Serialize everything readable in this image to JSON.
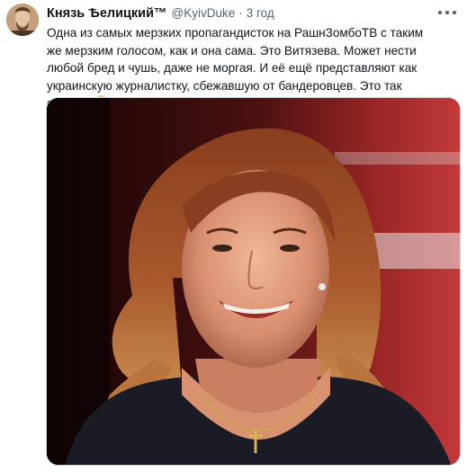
{
  "tweet": {
    "display_name": "Князь Ѣелицкий™",
    "handle": "@KyivDuke",
    "separator": "·",
    "time": "3 год",
    "text": "Одна из самых мерзких пропагандисток на РашнЗомбоТВ с таким же мерзким голосом, как и она сама. Это Витязева. Может нести любой бред и чушь, даже не моргая. И её ещё представляют как украинскую журналистку, сбежавшую от бандеровцев. Это так смешно",
    "emoji": "grinning-squinting-face",
    "more_icon": "more-horizontal-icon"
  },
  "media": {
    "description_icon": "photo"
  },
  "colors": {
    "text_primary": "#0f1419",
    "text_secondary": "#536471",
    "border": "#cfd9de"
  }
}
